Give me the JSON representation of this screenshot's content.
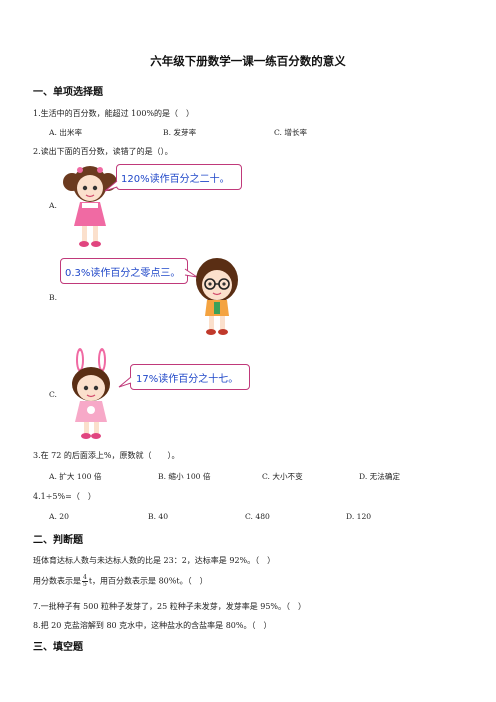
{
  "title": "六年级下册数学一课一练百分数的意义",
  "sections": {
    "s1": "一、单项选择题",
    "s2": "二、判断题",
    "s3": "三、填空题"
  },
  "q1": {
    "text": "1.生活中的百分数，能超过 100%的是（　）",
    "options": [
      "A. 出米率",
      "B. 发芽率",
      "C. 增长率"
    ]
  },
  "q2": {
    "text": "2.读出下面的百分数，读错了的是（）。",
    "a_label": "A.",
    "a_bubble": "120%读作百分之二十。",
    "b_label": "B.",
    "b_bubble": "0.3%读作百分之零点三。",
    "c_label": "C.",
    "c_bubble": "17%读作百分之十七。"
  },
  "q3": {
    "text": "3.在 72 的后面添上%，原数就（　　）。",
    "options": [
      "A. 扩大 100 倍",
      "B. 缩小 100 倍",
      "C. 大小不变",
      "D. 无法确定"
    ]
  },
  "q4": {
    "text": "4.1÷5%=（　）",
    "options": [
      "A. 20",
      "B. 40",
      "C. 480",
      "D. 120"
    ]
  },
  "judge": {
    "q5": "班体育达标人数与未达标人数的比是 23：2，达标率是 92%。（　）",
    "q6_pre": "用分数表示是",
    "q6_num": "4",
    "q6_den": "5",
    "q6_post": "t，用百分数表示是 80%t。（　）",
    "q7": "7.一批种子有 500 粒种子发芽了，25 粒种子未发芽，发芽率是 95%。（　）",
    "q8": "8.把 20 克盐溶解到 80 克水中，这种盐水的含盐率是 80%。（　）"
  },
  "colors": {
    "bubble_border": "#c0397a",
    "bubble_text": "#1f47c8",
    "girl_dress_pink": "#f06aa3",
    "hair_brown": "#6b3a1f"
  }
}
